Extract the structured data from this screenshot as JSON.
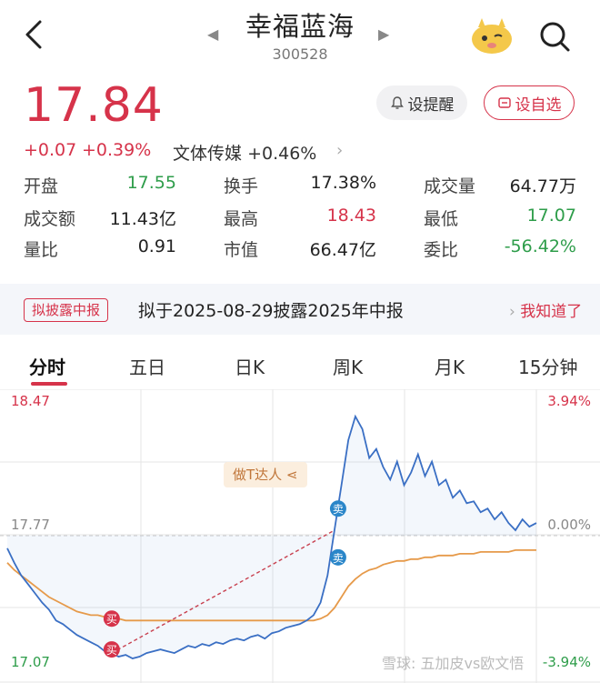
{
  "header": {
    "title": "幸福蓝海",
    "code": "300528",
    "prev_arrow": "◀",
    "next_arrow": "▶"
  },
  "quote": {
    "price": "17.84",
    "change": "+0.07",
    "change_pct": "+0.39%",
    "sector_name": "文体传媒",
    "sector_change": "+0.46%",
    "alert_label": "设提醒",
    "watchlist_label": "设自选"
  },
  "stats": [
    {
      "label": "开盘",
      "value": "17.55",
      "color": "green"
    },
    {
      "label": "换手",
      "value": "17.38%",
      "color": "dark"
    },
    {
      "label": "成交量",
      "value": "64.77万",
      "color": "dark"
    },
    {
      "label": "成交额",
      "value": "11.43亿",
      "color": "dark"
    },
    {
      "label": "最高",
      "value": "18.43",
      "color": "red"
    },
    {
      "label": "最低",
      "value": "17.07",
      "color": "green"
    },
    {
      "label": "量比",
      "value": "0.91",
      "color": "dark"
    },
    {
      "label": "市值",
      "value": "66.47亿",
      "color": "dark"
    },
    {
      "label": "委比",
      "value": "-56.42%",
      "color": "green"
    }
  ],
  "banner": {
    "tag": "拟披露中报",
    "text": "拟于2025-08-29披露2025年中报",
    "link": "我知道了"
  },
  "tabs": [
    "分时",
    "五日",
    "日K",
    "周K",
    "月K",
    "15分钟"
  ],
  "chart_data": {
    "type": "line",
    "y_left_ticks": [
      "18.47",
      "17.77",
      "17.07"
    ],
    "y_right_ticks": [
      "3.94%",
      "0.00%",
      "-3.94%"
    ],
    "ylim": [
      17.07,
      18.47
    ],
    "grid": true,
    "series": [
      {
        "values": [
          17.7,
          17.62,
          17.55,
          17.5,
          17.45,
          17.4,
          17.36,
          17.3,
          17.28,
          17.25,
          17.22,
          17.2,
          17.18,
          17.16,
          17.13,
          17.12,
          17.1,
          17.11,
          17.09,
          17.1,
          17.12,
          17.13,
          17.14,
          17.13,
          17.12,
          17.14,
          17.16,
          17.15,
          17.17,
          17.16,
          17.18,
          17.17,
          17.19,
          17.2,
          17.19,
          17.21,
          17.22,
          17.2,
          17.23,
          17.24,
          17.26,
          17.27,
          17.28,
          17.3,
          17.33,
          17.4,
          17.55,
          17.8,
          18.05,
          18.3,
          18.43,
          18.36,
          18.2,
          18.25,
          18.15,
          18.08,
          18.18,
          18.05,
          18.12,
          18.22,
          18.1,
          18.18,
          18.05,
          18.08,
          17.98,
          18.02,
          17.95,
          17.96,
          17.9,
          17.92,
          17.86,
          17.9,
          17.84,
          17.8,
          17.86,
          17.82,
          17.84
        ]
      },
      {
        "values": [
          17.62,
          17.58,
          17.55,
          17.52,
          17.49,
          17.46,
          17.43,
          17.41,
          17.39,
          17.37,
          17.35,
          17.34,
          17.33,
          17.33,
          17.32,
          17.31,
          17.31,
          17.3,
          17.3,
          17.3,
          17.3,
          17.3,
          17.3,
          17.3,
          17.3,
          17.3,
          17.3,
          17.3,
          17.3,
          17.3,
          17.3,
          17.3,
          17.3,
          17.3,
          17.3,
          17.3,
          17.3,
          17.3,
          17.3,
          17.3,
          17.3,
          17.3,
          17.3,
          17.3,
          17.3,
          17.31,
          17.33,
          17.37,
          17.43,
          17.49,
          17.53,
          17.56,
          17.58,
          17.59,
          17.61,
          17.62,
          17.63,
          17.63,
          17.64,
          17.64,
          17.65,
          17.65,
          17.66,
          17.66,
          17.66,
          17.67,
          17.67,
          17.67,
          17.68,
          17.68,
          17.68,
          17.68,
          17.68,
          17.69,
          17.69,
          17.69,
          17.69
        ]
      }
    ],
    "markers": [
      {
        "label": "买",
        "type": "buy"
      },
      {
        "label": "买",
        "type": "buy"
      },
      {
        "label": "卖",
        "type": "sell"
      },
      {
        "label": "卖",
        "type": "sell"
      }
    ],
    "badge": "做T达人"
  },
  "watermark": "雪球: 五加皮vs欧文悟",
  "colors": {
    "red": "#d6334a",
    "green": "#2e9d4a",
    "price_line": "#3a6fc4",
    "avg_line": "#e69a4a"
  }
}
